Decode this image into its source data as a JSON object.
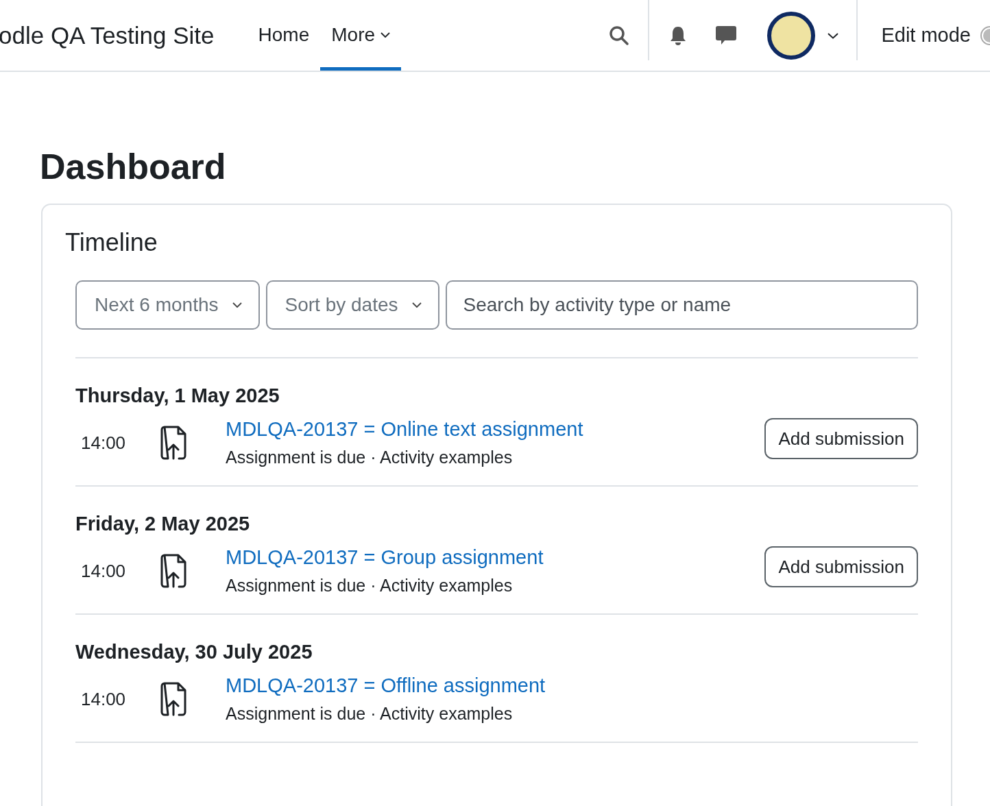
{
  "navbar": {
    "brand": "odle QA Testing Site",
    "nav_items": [
      {
        "label": "Home",
        "selected": false,
        "dropdown": false
      },
      {
        "label": "More",
        "selected": true,
        "dropdown": true
      }
    ],
    "edit_mode": {
      "label": "Edit mode",
      "on": false
    }
  },
  "page_title": "Dashboard",
  "timeline": {
    "title": "Timeline",
    "filters": [
      {
        "kind": "select",
        "label": "Next 6 months"
      },
      {
        "kind": "select",
        "label": "Sort by dates"
      },
      {
        "kind": "search",
        "placeholder": "Search by activity type or name"
      }
    ],
    "days": [
      {
        "date": "Thursday, 1 May 2025",
        "events": [
          {
            "time": "14:00",
            "title": "MDLQA-20137 = Online text assignment",
            "detail": "Assignment is due · Activity examples",
            "action": "Add submission"
          }
        ]
      },
      {
        "date": "Friday, 2 May 2025",
        "events": [
          {
            "time": "14:00",
            "title": "MDLQA-20137 = Group assignment",
            "detail": "Assignment is due · Activity examples",
            "action": "Add submission"
          }
        ]
      },
      {
        "date": "Wednesday, 30 July 2025",
        "events": [
          {
            "time": "14:00",
            "title": "MDLQA-20137 = Offline assignment",
            "detail": "Assignment is due · Activity examples"
          }
        ]
      }
    ]
  }
}
